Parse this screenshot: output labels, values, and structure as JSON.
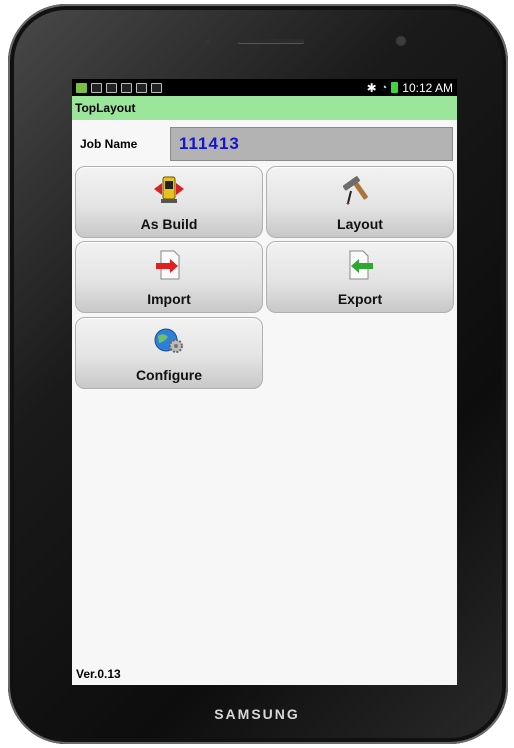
{
  "device": {
    "brand": "SAMSUNG"
  },
  "status_bar": {
    "time": "10:12 AM"
  },
  "app": {
    "title": "TopLayout"
  },
  "job": {
    "label": "Job Name",
    "value": "111413"
  },
  "buttons": {
    "as_build": {
      "label": "As Build",
      "icon": "surveying-instrument-icon"
    },
    "layout": {
      "label": "Layout",
      "icon": "hammer-icon"
    },
    "import": {
      "label": "Import",
      "icon": "import-file-icon"
    },
    "export": {
      "label": "Export",
      "icon": "export-file-icon"
    },
    "configure": {
      "label": "Configure",
      "icon": "globe-gear-icon"
    }
  },
  "footer": {
    "version": "Ver.0.13"
  },
  "colors": {
    "titlebar": "#9be69b",
    "job_value": "#1515d0",
    "import_arrow": "#e02020",
    "export_arrow": "#2ea82e"
  }
}
